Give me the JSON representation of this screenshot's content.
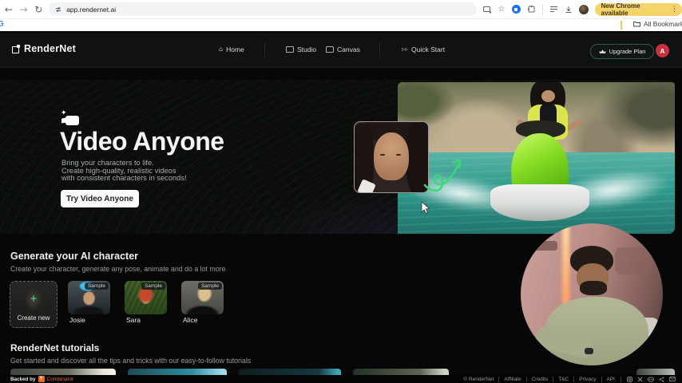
{
  "browser": {
    "url": "app.rendernet.ai",
    "new_chrome_label": "New Chrome available",
    "all_bookmarks_label": "All Bookmarks"
  },
  "header": {
    "logo_text": "RenderNet",
    "nav": [
      {
        "label": "Home"
      },
      {
        "label": "Studio"
      },
      {
        "label": "Canvas"
      },
      {
        "label": "Quick Start"
      }
    ],
    "upgrade_label": "Upgrade Plan",
    "avatar_initial": "A"
  },
  "hero": {
    "title": "Video Anyone",
    "subtitle_line1": "Bring your characters to life.",
    "subtitle_line2": "Create high-quality, realistic videos",
    "subtitle_line3": "with consistent characters in seconds!",
    "cta_label": "Try Video Anyone"
  },
  "characters": {
    "title": "Generate your AI character",
    "subtitle": "Create your character, generate any pose, animate and do a lot more",
    "create_new_label": "Create new",
    "cards": [
      {
        "name": "Josie",
        "badge": "Sample"
      },
      {
        "name": "Sara",
        "badge": "Sample"
      },
      {
        "name": "Alice",
        "badge": "Sample"
      }
    ]
  },
  "tutorials": {
    "title": "RenderNet tutorials",
    "subtitle": "Get started and discover all the tips and tricks with our easy-to-follow tutorials"
  },
  "footer": {
    "backed_by": "Backed by",
    "yc_letter": "Y",
    "yc_name": "Combinator",
    "copyright": "© RenderNet",
    "links": [
      {
        "label": "Affiliate"
      },
      {
        "label": "Credits"
      },
      {
        "label": "T&C"
      },
      {
        "label": "Privacy"
      },
      {
        "label": "API"
      }
    ]
  },
  "colors": {
    "accent_green": "#35d07f",
    "upgrade_border": "#2e5b4c",
    "avatar_red": "#c8303c",
    "chrome_update_bg": "#f5d469",
    "yc_orange": "#f26522",
    "water_teal": "#2f9a8d",
    "jetski_green": "#84dc22"
  }
}
